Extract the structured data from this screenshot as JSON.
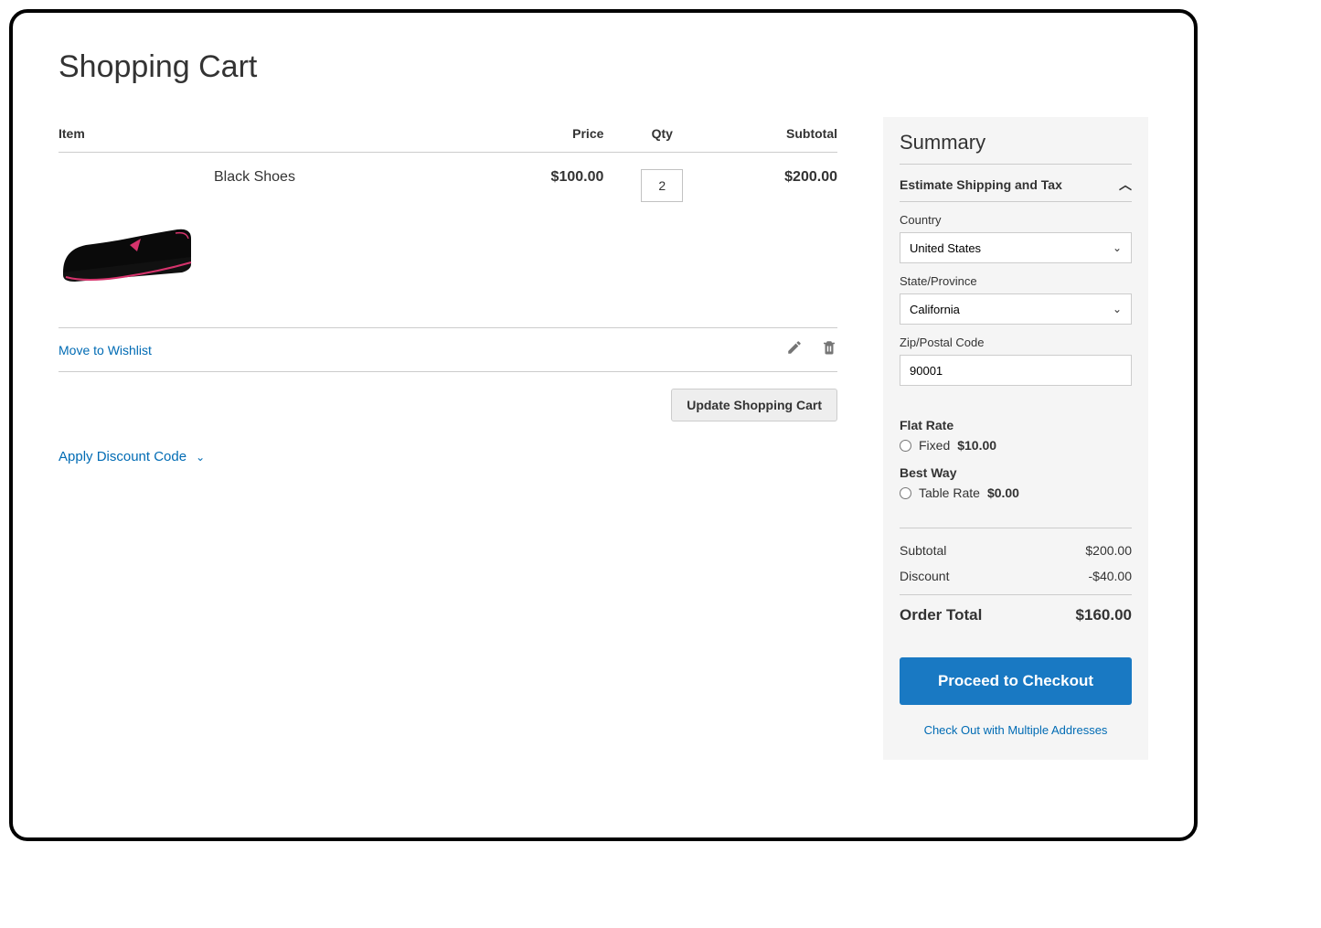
{
  "page": {
    "title": "Shopping Cart"
  },
  "cart": {
    "headers": {
      "item": "Item",
      "price": "Price",
      "qty": "Qty",
      "subtotal": "Subtotal"
    },
    "items": [
      {
        "name": "Black Shoes",
        "price": "$100.00",
        "qty": "2",
        "subtotal": "$200.00"
      }
    ],
    "wishlist_link": "Move to Wishlist",
    "update_button": "Update Shopping Cart",
    "discount_toggle": "Apply Discount Code"
  },
  "summary": {
    "title": "Summary",
    "estimate_toggle": "Estimate Shipping and Tax",
    "fields": {
      "country_label": "Country",
      "country_value": "United States",
      "state_label": "State/Province",
      "state_value": "California",
      "zip_label": "Zip/Postal Code",
      "zip_value": "90001"
    },
    "shipping": {
      "flat_rate_title": "Flat Rate",
      "flat_rate_option": "Fixed",
      "flat_rate_cost": "$10.00",
      "best_way_title": "Best Way",
      "best_way_option": "Table Rate",
      "best_way_cost": "$0.00"
    },
    "totals": {
      "subtotal_label": "Subtotal",
      "subtotal_value": "$200.00",
      "discount_label": "Discount",
      "discount_value": "-$40.00",
      "order_total_label": "Order Total",
      "order_total_value": "$160.00"
    },
    "checkout_button": "Proceed to Checkout",
    "multi_address_link": "Check Out with Multiple Addresses"
  }
}
